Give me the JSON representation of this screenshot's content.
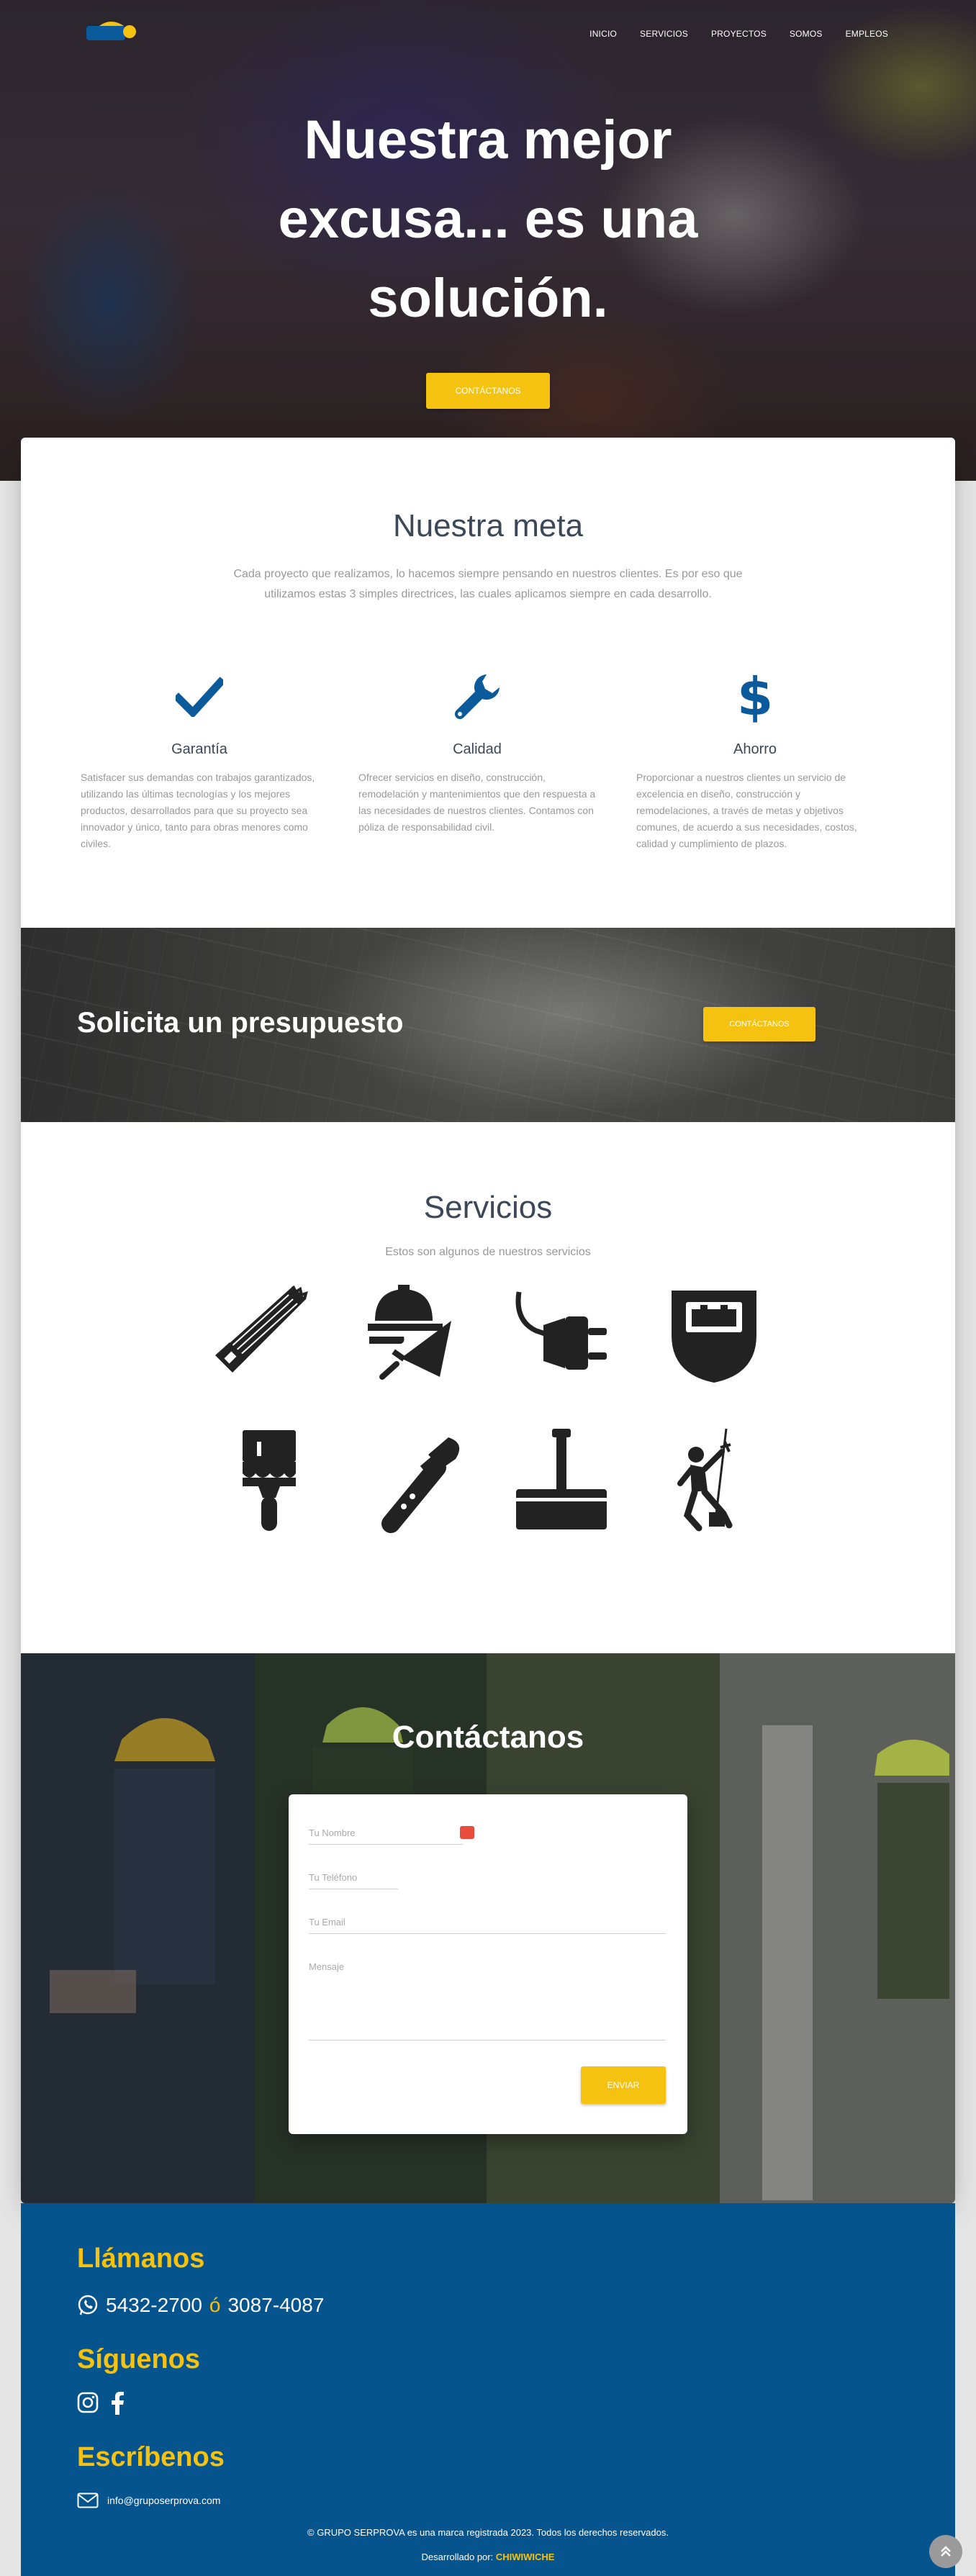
{
  "nav": {
    "items": [
      "INICIO",
      "SERVICIOS",
      "PROYECTOS",
      "SOMOS",
      "EMPLEOS"
    ],
    "logo_icon": "grupo-serprova-logo"
  },
  "hero": {
    "title_line1": "Nuestra mejor",
    "title_line2": "excusa... es una",
    "title_line3": "solución.",
    "button": "CONTÁCTANOS"
  },
  "meta": {
    "title": "Nuestra meta",
    "text": "Cada proyecto que realizamos, lo hacemos siempre pensando en nuestros clientes. Es por eso que utilizamos estas 3 simples directrices, las cuales aplicamos siempre en cada desarrollo.",
    "features": [
      {
        "icon": "check-icon",
        "title": "Garantía",
        "text": "Satisfacer sus demandas con trabajos garantizados, utilizando las últimas tecnologías y los mejores productos, desarrollados para que su proyecto sea innovador y único, tanto para obras menores como civiles."
      },
      {
        "icon": "wrench-icon",
        "title": "Calidad",
        "text": "Ofrecer servicios en diseño, construcción, remodelación y mantenimientos que den respuesta a las necesidades de nuestros clientes. Contamos con póliza de responsabilidad civil."
      },
      {
        "icon": "dollar-icon",
        "title": "Ahorro",
        "text": "Proporcionar a nuestros clientes un servicio de excelencia en diseño, construcción y remodelaciones, a través de metas y objetivos comunes, de acuerdo a sus necesidades, costos, calidad y cumplimiento de plazos."
      }
    ]
  },
  "presupuesto": {
    "title": "Solicita un presupuesto",
    "button": "CONTÁCTANOS"
  },
  "servicios": {
    "title": "Servicios",
    "subtitle": "Estos son algunos de nuestros servicios",
    "icons": [
      "saw-icon",
      "masonry-icon",
      "electric-plug-icon",
      "welding-mask-icon",
      "paint-brush-icon",
      "pipe-wrench-icon",
      "floor-squeegee-icon",
      "rope-access-worker-icon"
    ]
  },
  "contacto": {
    "title": "Contáctanos",
    "name_placeholder": "Tu Nombre",
    "phone_placeholder": "Tu Teléfono",
    "email_placeholder": "Tu Email",
    "message_placeholder": "Mensaje",
    "button": "ENVIAR"
  },
  "footer": {
    "call_title": "Llámanos",
    "phone1": "5432-2700",
    "or": "ó",
    "phone2": "3087-4087",
    "follow_title": "Síguenos",
    "write_title": "Escríbenos",
    "email": "info@gruposerprova.com",
    "copyright": "© GRUPO SERPROVA es una marca registrada 2023. Todos los derechos reservados.",
    "dev_label": "Desarrollado por:",
    "dev_name": "CHIWIWICHE"
  },
  "colors": {
    "accent": "#f5c30f",
    "footer": "#06548e",
    "icon_blue": "#0a5a9c"
  }
}
